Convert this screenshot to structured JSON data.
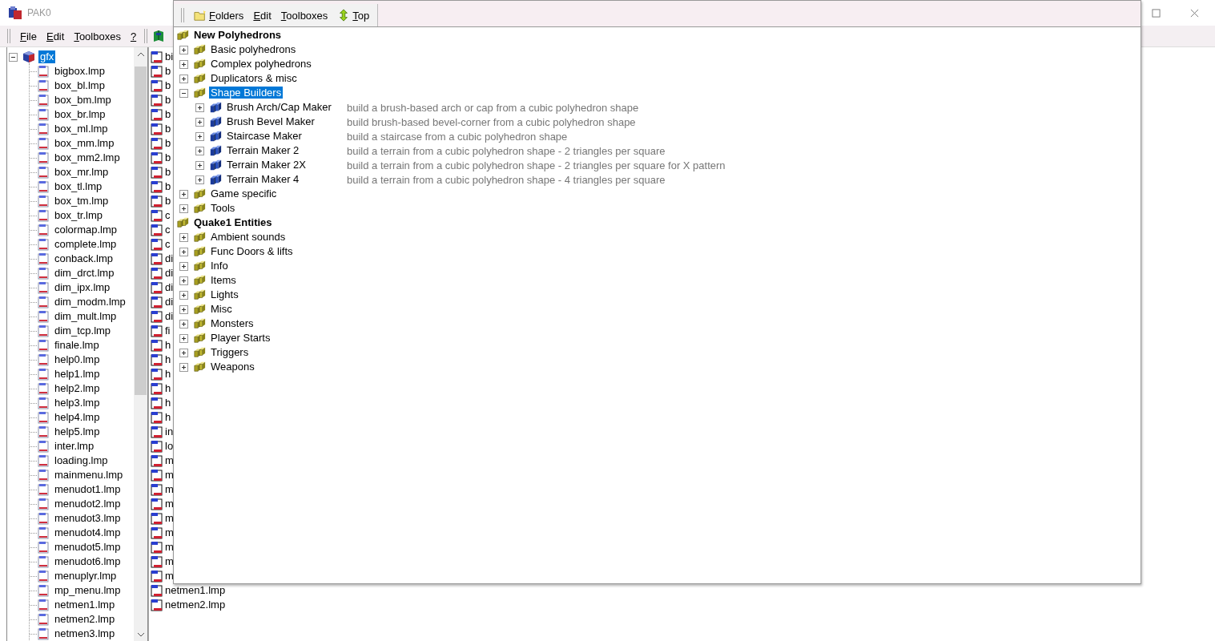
{
  "main_window": {
    "title": "PAK0",
    "menu": [
      "File",
      "Edit",
      "Toolboxes",
      "?"
    ],
    "file_tree": {
      "label": "gfx",
      "selected": true,
      "expanded": true,
      "items": [
        "bigbox.lmp",
        "box_bl.lmp",
        "box_bm.lmp",
        "box_br.lmp",
        "box_ml.lmp",
        "box_mm.lmp",
        "box_mm2.lmp",
        "box_mr.lmp",
        "box_tl.lmp",
        "box_tm.lmp",
        "box_tr.lmp",
        "colormap.lmp",
        "complete.lmp",
        "conback.lmp",
        "dim_drct.lmp",
        "dim_ipx.lmp",
        "dim_modm.lmp",
        "dim_mult.lmp",
        "dim_tcp.lmp",
        "finale.lmp",
        "help0.lmp",
        "help1.lmp",
        "help2.lmp",
        "help3.lmp",
        "help4.lmp",
        "help5.lmp",
        "inter.lmp",
        "loading.lmp",
        "mainmenu.lmp",
        "menudot1.lmp",
        "menudot2.lmp",
        "menudot3.lmp",
        "menudot4.lmp",
        "menudot5.lmp",
        "menudot6.lmp",
        "menuplyr.lmp",
        "mp_menu.lmp",
        "netmen1.lmp",
        "netmen2.lmp",
        "netmen3.lmp"
      ]
    },
    "file_list": [
      "bi",
      "b",
      "b",
      "b",
      "b",
      "b",
      "b",
      "b",
      "b",
      "b",
      "b",
      "c",
      "c",
      "c",
      "di",
      "di",
      "di",
      "di",
      "di",
      "fi",
      "h",
      "h",
      "h",
      "h",
      "h",
      "h",
      "in",
      "lo",
      "m",
      "m",
      "m",
      "m",
      "m",
      "m",
      "m",
      "m",
      "m",
      "netmen1.lmp",
      "netmen2.lmp"
    ]
  },
  "toolbox_window": {
    "toolbar": [
      {
        "label": "Folders",
        "kind": "folders"
      },
      {
        "label": "Edit",
        "kind": "text"
      },
      {
        "label": "Toolboxes",
        "kind": "text"
      },
      {
        "label": "Top",
        "kind": "top"
      }
    ],
    "tree": [
      {
        "label": "New Polyhedrons",
        "kind": "group",
        "selected": false,
        "children": [
          {
            "label": "Basic polyhedrons",
            "kind": "group",
            "expanded": false,
            "selected": false
          },
          {
            "label": "Complex polyhedrons",
            "kind": "group",
            "expanded": false,
            "selected": false
          },
          {
            "label": "Duplicators & misc",
            "kind": "group",
            "expanded": false,
            "selected": false
          },
          {
            "label": "Shape Builders",
            "kind": "group",
            "expanded": true,
            "selected": true,
            "children": [
              {
                "label": "Brush Arch/Cap Maker",
                "kind": "toolbox",
                "expanded": false,
                "selected": false,
                "description": "build a brush-based arch or cap from a cubic polyhedron shape"
              },
              {
                "label": "Brush Bevel Maker",
                "kind": "toolbox",
                "expanded": false,
                "selected": false,
                "description": "build brush-based bevel-corner from a cubic polyhedron shape"
              },
              {
                "label": "Staircase Maker",
                "kind": "toolbox",
                "expanded": false,
                "selected": false,
                "description": "build a staircase from a cubic polyhedron shape"
              },
              {
                "label": "Terrain Maker 2",
                "kind": "toolbox",
                "expanded": false,
                "selected": false,
                "description": "build a terrain from a cubic polyhedron shape - 2 triangles per square"
              },
              {
                "label": "Terrain Maker 2X",
                "kind": "toolbox",
                "expanded": false,
                "selected": false,
                "description": "build a terrain from a cubic polyhedron shape - 2 triangles per square for X pattern"
              },
              {
                "label": "Terrain Maker 4",
                "kind": "toolbox",
                "expanded": false,
                "selected": false,
                "description": "build a terrain from a cubic polyhedron shape - 4 triangles per square"
              }
            ]
          },
          {
            "label": "Game specific",
            "kind": "group",
            "expanded": false,
            "selected": false
          },
          {
            "label": "Tools",
            "kind": "group",
            "expanded": false,
            "selected": false
          }
        ]
      },
      {
        "label": "Quake1 Entities",
        "kind": "group",
        "selected": false,
        "children": [
          {
            "label": "Ambient sounds",
            "kind": "group",
            "expanded": false,
            "selected": false
          },
          {
            "label": "Func Doors & lifts",
            "kind": "group",
            "expanded": false,
            "selected": false
          },
          {
            "label": "Info",
            "kind": "group",
            "expanded": false,
            "selected": false
          },
          {
            "label": "Items",
            "kind": "group",
            "expanded": false,
            "selected": false
          },
          {
            "label": "Lights",
            "kind": "group",
            "expanded": false,
            "selected": false
          },
          {
            "label": "Misc",
            "kind": "group",
            "expanded": false,
            "selected": false
          },
          {
            "label": "Monsters",
            "kind": "group",
            "expanded": false,
            "selected": false
          },
          {
            "label": "Player Starts",
            "kind": "group",
            "expanded": false,
            "selected": false
          },
          {
            "label": "Triggers",
            "kind": "group",
            "expanded": false,
            "selected": false
          },
          {
            "label": "Weapons",
            "kind": "group",
            "expanded": false,
            "selected": false
          }
        ]
      }
    ]
  }
}
